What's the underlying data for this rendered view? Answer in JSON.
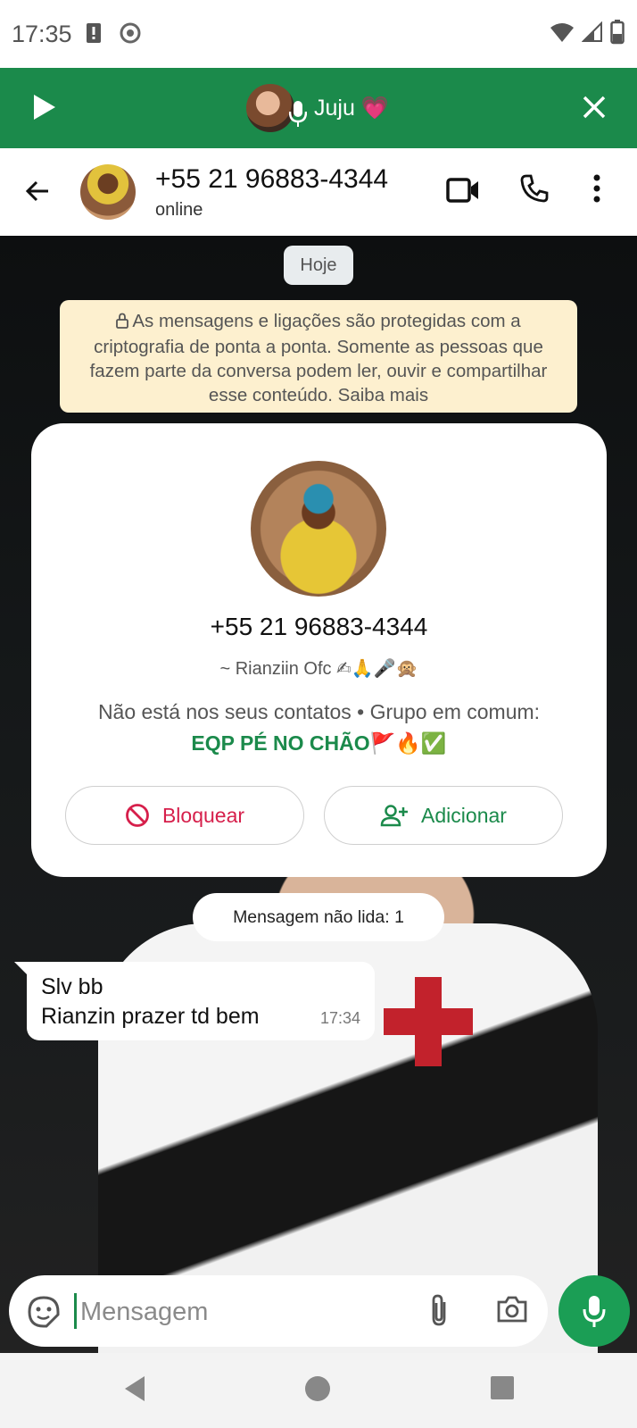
{
  "status_bar": {
    "time": "17:35",
    "icons": [
      "alert-icon",
      "chrome-icon",
      "wifi-icon",
      "signal-icon",
      "battery-icon"
    ]
  },
  "voice_banner": {
    "name": "Juju 💗",
    "icons": [
      "play-icon",
      "mic-icon",
      "close-icon"
    ]
  },
  "chat_header": {
    "title": "+55 21 96883-4344",
    "status": "online",
    "icons": [
      "back-arrow-icon",
      "video-call-icon",
      "phone-icon",
      "more-vert-icon"
    ]
  },
  "chat": {
    "date_chip": "Hoje",
    "encryption_notice": "As mensagens e ligações são protegidas com a criptografia de ponta a ponta. Somente as pessoas que fazem parte da conversa podem ler, ouvir e compartilhar esse conteúdo. Saiba mais",
    "contact_card": {
      "number": "+55 21 96883-4344",
      "name": "~ Rianziin Ofc ✍🙏🎤🙊",
      "info_prefix": "Não está nos seus contatos • Grupo em comum: ",
      "group_name": "EQP PÉ NO CHÃO🚩🔥✅",
      "block_label": "Bloquear",
      "add_label": "Adicionar"
    },
    "unread_chip": "Mensagem não lida: 1",
    "messages": [
      {
        "line1": "Slv bb",
        "line2": "Rianzin prazer td bem",
        "time": "17:34"
      }
    ]
  },
  "composer": {
    "placeholder": "Mensagem"
  },
  "colors": {
    "accent_green": "#1b8a4b",
    "block_red": "#d61f4b",
    "notice_yellow": "#fdf0cf"
  }
}
